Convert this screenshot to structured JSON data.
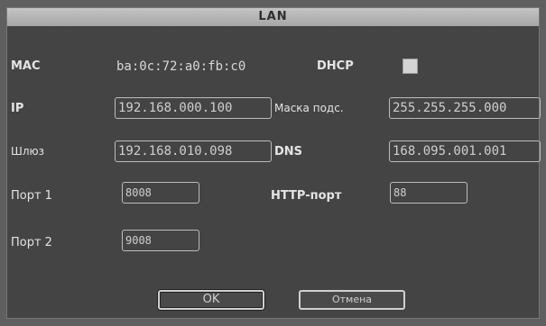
{
  "window": {
    "title": "LAN"
  },
  "mac": {
    "label": "MAC",
    "value": "ba:0c:72:a0:fb:c0"
  },
  "dhcp": {
    "label": "DHCP",
    "checked": true
  },
  "ip": {
    "label": "IP",
    "value": "192.168.000.100"
  },
  "mask": {
    "label": "Маска подс.",
    "value": "255.255.255.000"
  },
  "gateway": {
    "label": "Шлюз",
    "value": "192.168.010.098"
  },
  "dns": {
    "label": "DNS",
    "value": "168.095.001.001"
  },
  "port1": {
    "label": "Порт 1",
    "value": "8008"
  },
  "http_port": {
    "label": "HTTP-порт",
    "value": "88"
  },
  "port2": {
    "label": "Порт 2",
    "value": "9008"
  },
  "buttons": {
    "ok": "OK",
    "cancel": "Отмена"
  }
}
